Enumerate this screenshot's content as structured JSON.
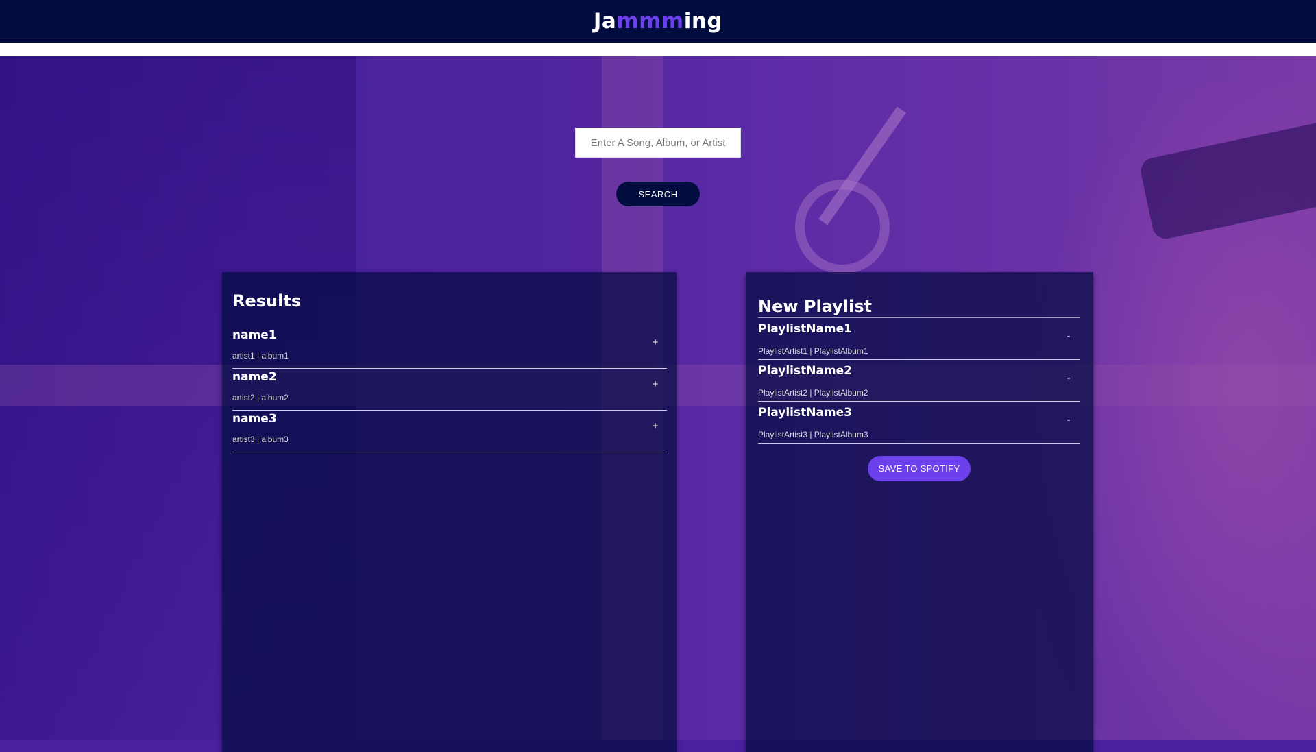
{
  "app": {
    "logo_part1": "Ja",
    "logo_part2": "mmm",
    "logo_part3": "ing"
  },
  "search": {
    "placeholder": "Enter A Song, Album, or Artist",
    "value": "",
    "button_label": "SEARCH"
  },
  "results": {
    "title": "Results",
    "tracks": [
      {
        "name": "name1",
        "info": "artist1 | album1",
        "action": "+"
      },
      {
        "name": "name2",
        "info": "artist2 | album2",
        "action": "+"
      },
      {
        "name": "name3",
        "info": "artist3 | album3",
        "action": "+"
      }
    ]
  },
  "playlist": {
    "title": "New Playlist",
    "tracks": [
      {
        "name": "PlaylistName1",
        "info": "PlaylistArtist1 | PlaylistAlbum1",
        "action": "-"
      },
      {
        "name": "PlaylistName2",
        "info": "PlaylistArtist2 | PlaylistAlbum2",
        "action": "-"
      },
      {
        "name": "PlaylistName3",
        "info": "PlaylistArtist3 | PlaylistAlbum3",
        "action": "-"
      }
    ],
    "save_label": "SAVE TO SPOTIFY"
  },
  "colors": {
    "header_bg": "#010c3f",
    "accent": "#6c41ec",
    "panel_bg": "rgba(1,12,63,0.7)"
  }
}
